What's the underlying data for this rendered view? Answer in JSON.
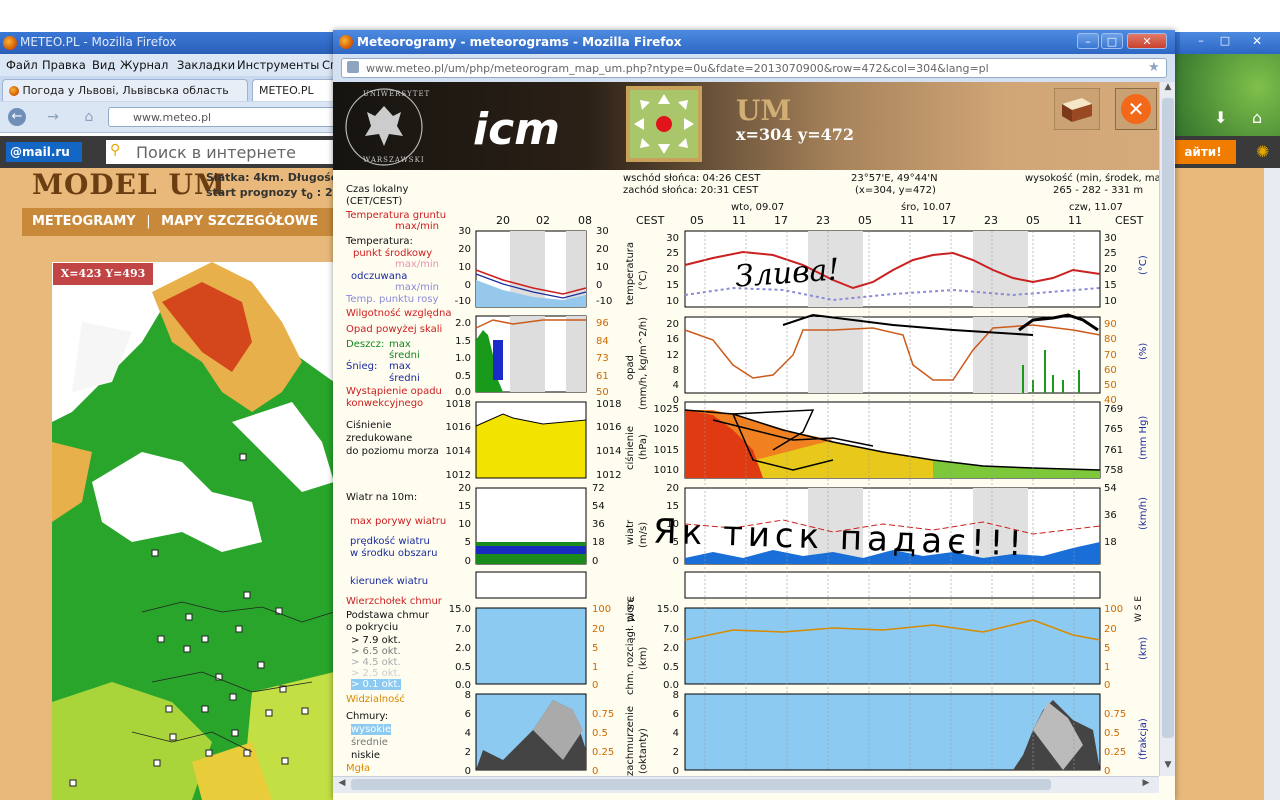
{
  "background_window": {
    "title": "METEO.PL - Mozilla Firefox",
    "menu": [
      "Файл",
      "Правка",
      "Вид",
      "Журнал",
      "Закладки",
      "Инструменты",
      "Сп"
    ],
    "tabs": [
      "Погода у Львові, Львівська область",
      "METEO.PL"
    ],
    "url": "www.meteo.pl",
    "search_placeholder": "Поиск в интернете",
    "mail_logo": "@mail.ru",
    "search_go": "айти!",
    "page_title": "MODEL UM",
    "page_info_line1": "Siatka: 4km. Długość pr",
    "page_info_line2": "start prognozy t",
    "page_info_line2b": "0",
    "page_info_line2c": ": 20",
    "nav_meteograms": "METEOGRAMY",
    "nav_sep": "|",
    "nav_maps": "MAPY SZCZEGÓŁOWE",
    "map_coord": "X=423 Y=493"
  },
  "popup": {
    "title": "Meteorogramy - meteorograms - Mozilla Firefox",
    "url": "www.meteo.pl/um/php/meteorogram_map_um.php?ntype=0u&fdate=2013070900&row=472&col=304&lang=pl",
    "model": "UM",
    "coords": "x=304   y=472",
    "close_symbol": "✕",
    "logo_uni_top": "UNIWERSYTET",
    "logo_uni_bottom": "WARSZAWSKI",
    "logo_icm": "icm"
  },
  "meteogram": {
    "sunrise": "wschód słońca: 04:26 CEST",
    "sunset": "zachód słońca: 20:31 CEST",
    "location": "23°57'E, 49°44'N",
    "location2": "(x=304,  y=472)",
    "height_label": "wysokość (min, środek, max",
    "height_values": "265 - 282 - 331 m",
    "days": [
      "wto, 09.07",
      "śro, 10.07",
      "czw, 11.07"
    ],
    "tz_left": "CEST",
    "tz_right": "CEST",
    "legend_hours": [
      "20",
      "02",
      "08"
    ],
    "main_hours": [
      "05",
      "11",
      "17",
      "23",
      "05",
      "11",
      "17",
      "23",
      "05",
      "11"
    ],
    "legend": {
      "local_time": "Czas lokalny",
      "local_time2": "(CET/CEST)",
      "soil_temp": "Temperatura gruntu",
      "soil_temp2": "max/min",
      "temperature": "Temperatura:",
      "mid_point": "punkt środkowy",
      "mid_maxmin": "max/min",
      "felt": "odczuwana",
      "felt_maxmin": "max/min",
      "dew_point": "Temp. punktu rosy",
      "humidity": "Wilgotność względna",
      "precip": "Opad powyżej skali",
      "rain": "Deszcz:",
      "rain_max": "max",
      "rain_mid": "średni",
      "snow": "Śnieg:",
      "snow_max": "max",
      "snow_mid": "średni",
      "convective": "Wystąpienie opadu",
      "convective2": "konwekcyjnego",
      "pressure1": "Ciśnienie",
      "pressure2": "zredukowane",
      "pressure3": "do poziomu morza",
      "wind10": "Wiatr na 10m:",
      "gusts": "max porywy wiatru",
      "wind_speed": "prędkość wiatru",
      "wind_speed2": "w środku obszaru",
      "wind_dir": "kierunek wiatru",
      "cloud_top": "Wierzchołek chmur",
      "cloud_base": "Podstawa chmur",
      "cloud_cover": "o pokryciu",
      "okt79": "> 7.9 okt.",
      "okt65": "> 6.5 okt.",
      "okt45": "> 4.5 okt.",
      "okt25": "> 2.5 okt.",
      "okt01": "> 0.1 okt.",
      "visibility": "Widzialność",
      "clouds": "Chmury:",
      "high": "wysokie",
      "mid": "średnie",
      "low": "niskie",
      "fog": "Mgła"
    },
    "axis_titles": {
      "temp": "temperatura",
      "temp_unit": "(°C)",
      "precip": "opad",
      "precip_unit": "(mm/h, kg/m^2/h)",
      "pressure": "ciśnienie",
      "pressure_unit": "(hPa)",
      "wind": "wiatr",
      "wind_unit": "(m/s)",
      "cloud_base": "chm. rozciągł. pion.",
      "cloud_base_unit": "(km)",
      "clouds": "zachmurzenie",
      "clouds_unit": "(oktanty)",
      "right_temp_unit": "(°C)",
      "right_humid_unit": "(%)",
      "right_pres_unit": "(mm Hg)",
      "right_wind_unit": "(km/h)",
      "right_vis_unit": "(km)",
      "right_cloud_unit": "(frakcja)",
      "right_compass": "W S E",
      "right_compass_n": "N"
    },
    "ticks": {
      "temp": [
        "30",
        "25",
        "20",
        "15",
        "10"
      ],
      "temp_legend": [
        "30",
        "20",
        "10",
        "0",
        "-10"
      ],
      "precip": [
        "20",
        "16",
        "12",
        "8",
        "4",
        "0"
      ],
      "humid": [
        "90",
        "80",
        "70",
        "60",
        "50",
        "40"
      ],
      "precip_legend": [
        "2.0",
        "1.5",
        "1.0",
        "0.5",
        "0.0"
      ],
      "humid_legend": [
        "96",
        "84",
        "73",
        "61",
        "50"
      ],
      "pressure": [
        "1025",
        "1020",
        "1015",
        "1010"
      ],
      "pres_mm": [
        "769",
        "765",
        "761",
        "758"
      ],
      "pressure_legend": [
        "1018",
        "1016",
        "1014",
        "1012"
      ],
      "wind": [
        "20",
        "15",
        "10",
        "5",
        "0"
      ],
      "wind_kmh": [
        "54",
        "36",
        "18"
      ],
      "wind_legend_kmh": [
        "72",
        "54",
        "36",
        "18",
        "0"
      ],
      "cloud_km": [
        "15.0",
        "7.0",
        "2.0",
        "0.5",
        "0.0"
      ],
      "vis": [
        "100",
        "20",
        "5",
        "1",
        "0"
      ],
      "oktas": [
        "8",
        "6",
        "4",
        "2",
        "0"
      ],
      "fraction": [
        "0.75",
        "0.5",
        "0.25",
        "0"
      ]
    },
    "handwritten_1": "Злива!",
    "handwritten_2": "Як тиск падає!!!"
  },
  "colors": {
    "accent_firefox": "#2d67c4",
    "temp_red": "#cc1f1f",
    "humid_orange": "#cc5a1a",
    "pressure_yellow": "#f2e400",
    "precip_green": "#1a9a1a",
    "wind_blue": "#1a5ec8",
    "sky_blue": "#8ccaf2"
  }
}
